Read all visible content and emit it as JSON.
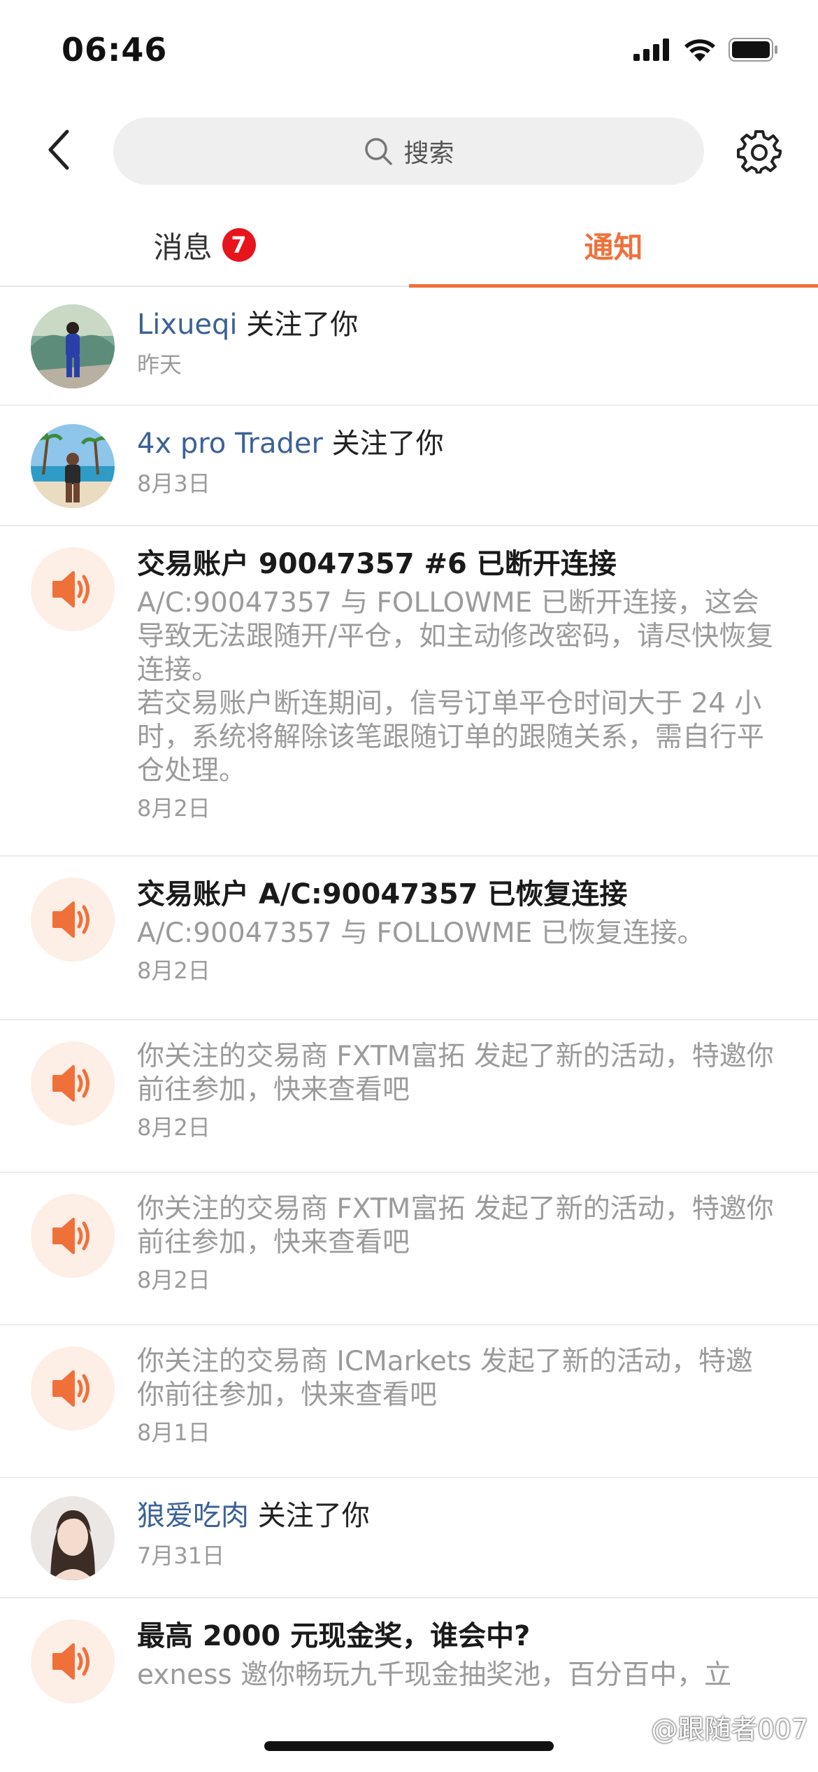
{
  "status_bar": {
    "time": "06:46",
    "signal_icon": "cellular-signal-icon",
    "wifi_icon": "wifi-icon",
    "battery_icon": "battery-icon"
  },
  "header": {
    "back_icon": "chevron-left-icon",
    "search_placeholder": "搜索",
    "search_icon": "search-icon",
    "settings_icon": "gear-icon"
  },
  "tabs": [
    {
      "label": "消息",
      "badge": "7",
      "active": false
    },
    {
      "label": "通知",
      "active": true
    }
  ],
  "colors": {
    "accent": "#f0703a",
    "badge": "#e8141c",
    "link": "#3c6296",
    "muted": "#9b9b9b"
  },
  "notifications": [
    {
      "type": "follow",
      "name": "Lixueqi",
      "action": "关注了你",
      "date": "昨天"
    },
    {
      "type": "follow",
      "name": "4x pro Trader",
      "action": "关注了你",
      "date": "8月3日"
    },
    {
      "type": "system",
      "title": "交易账户 90047357 #6 已断开连接",
      "body": "A/C:90047357 与 FOLLOWME 已断开连接，这会导致无法跟随开/平仓，如主动修改密码，请尽快恢复连接。",
      "body2": "若交易账户断连期间，信号订单平仓时间大于 24 小时，系统将解除该笔跟随订单的跟随关系，需自行平仓处理。",
      "date": "8月2日"
    },
    {
      "type": "system",
      "title": "交易账户 A/C:90047357 已恢复连接",
      "body": "A/C:90047357 与 FOLLOWME 已恢复连接。",
      "date": "8月2日"
    },
    {
      "type": "system",
      "body": "你关注的交易商 FXTM富拓 发起了新的活动，特邀你前往参加，快来查看吧",
      "date": "8月2日"
    },
    {
      "type": "system",
      "body": "你关注的交易商 FXTM富拓 发起了新的活动，特邀你前往参加，快来查看吧",
      "date": "8月2日"
    },
    {
      "type": "system",
      "body": "你关注的交易商 ICMarkets 发起了新的活动，特邀你前往参加，快来查看吧",
      "date": "8月1日"
    },
    {
      "type": "follow",
      "name": "狼爱吃肉",
      "action": "关注了你",
      "date": "7月31日"
    },
    {
      "type": "system",
      "title": "最高 2000 元现金奖，谁会中?",
      "body": "exness 邀你畅玩九千现金抽奖池，百分百中，立"
    }
  ],
  "watermark": "@跟随者007"
}
